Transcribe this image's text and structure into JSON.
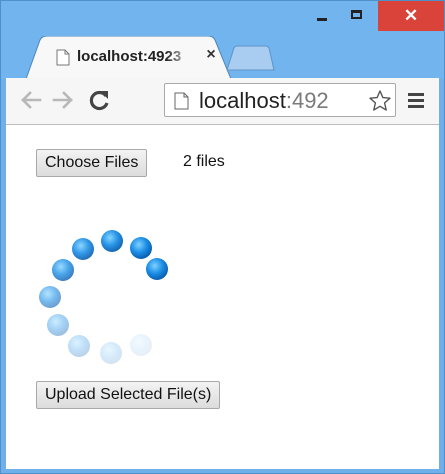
{
  "browser": {
    "tab": {
      "title": "localhost:4923",
      "close_glyph": "×"
    },
    "window_controls": {
      "close_glyph": "✕"
    },
    "omnibox": {
      "host": "localhost",
      "port_fragment": ":492"
    },
    "icons": {
      "back": "back-arrow-icon",
      "forward": "forward-arrow-icon",
      "reload": "reload-icon",
      "page": "page-icon",
      "star": "star-icon",
      "menu": "hamburger-menu-icon"
    },
    "colors": {
      "frame": "#72b4ee",
      "close_button": "#d9433a",
      "spinner": "#1c8ee6"
    }
  },
  "page": {
    "choose_files_label": "Choose Files",
    "file_status": "2 files",
    "upload_label": "Upload Selected File(s)"
  }
}
